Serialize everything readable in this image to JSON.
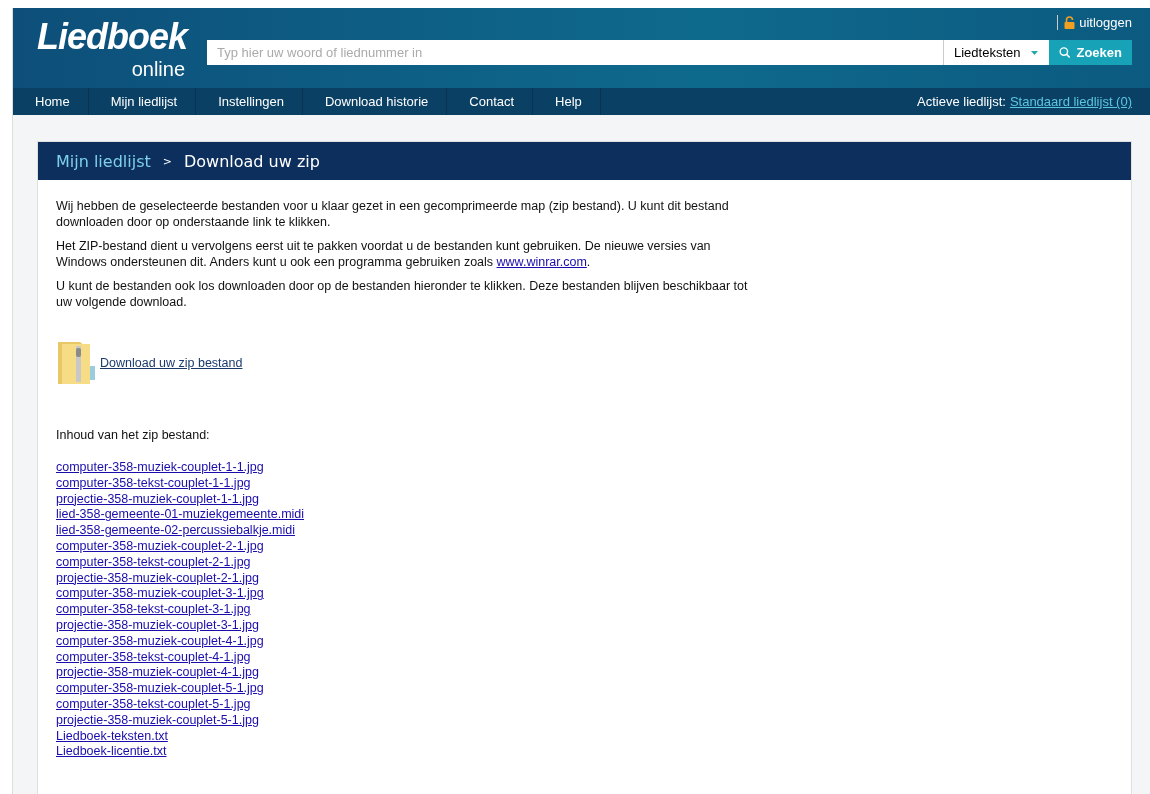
{
  "header": {
    "logo_main": "Liedboek",
    "logo_sub": "online",
    "logout": "uitloggen",
    "search": {
      "placeholder": "Typ hier uw woord of liednummer in",
      "scope": "Liedteksten",
      "button": "Zoeken"
    }
  },
  "nav": {
    "items": [
      {
        "label": "Home"
      },
      {
        "label": "Mijn liedlijst"
      },
      {
        "label": "Instellingen"
      },
      {
        "label": "Download historie"
      },
      {
        "label": "Contact"
      },
      {
        "label": "Help"
      }
    ],
    "active_label": "Actieve liedlijst:",
    "active_link": "Standaard liedlijst (0)"
  },
  "breadcrumb": {
    "parent": "Mijn liedlijst",
    "separator": ">",
    "current": "Download uw zip"
  },
  "paragraphs": [
    {
      "text": "Wij hebben de geselecteerde bestanden voor u klaar gezet in een gecomprimeerde map (zip bestand). U kunt dit bestand downloaden door op onderstaande link te klikken."
    },
    {
      "text": "Het ZIP-bestand dient u vervolgens eerst uit te pakken voordat u de bestanden kunt gebruiken. De nieuwe versies van Windows ondersteunen dit. Anders kunt u ook een programma gebruiken zoals ",
      "link": "www.winrar.com",
      "after": "."
    },
    {
      "text": "U kunt de bestanden ook los downloaden door op de bestanden hieronder te klikken. Deze bestanden blijven beschikbaar tot uw volgende download."
    }
  ],
  "zip_link": "Download uw zip bestand",
  "contents_label": "Inhoud van het zip bestand:",
  "files": [
    "computer-358-muziek-couplet-1-1.jpg",
    "computer-358-tekst-couplet-1-1.jpg",
    "projectie-358-muziek-couplet-1-1.jpg",
    "lied-358-gemeente-01-muziekgemeente.midi",
    "lied-358-gemeente-02-percussiebalkje.midi",
    "computer-358-muziek-couplet-2-1.jpg",
    "computer-358-tekst-couplet-2-1.jpg",
    "projectie-358-muziek-couplet-2-1.jpg",
    "computer-358-muziek-couplet-3-1.jpg",
    "computer-358-tekst-couplet-3-1.jpg",
    "projectie-358-muziek-couplet-3-1.jpg",
    "computer-358-muziek-couplet-4-1.jpg",
    "computer-358-tekst-couplet-4-1.jpg",
    "projectie-358-muziek-couplet-4-1.jpg",
    "computer-358-muziek-couplet-5-1.jpg",
    "computer-358-tekst-couplet-5-1.jpg",
    "projectie-358-muziek-couplet-5-1.jpg",
    "Liedboek-teksten.txt",
    "Liedboek-licentie.txt"
  ]
}
